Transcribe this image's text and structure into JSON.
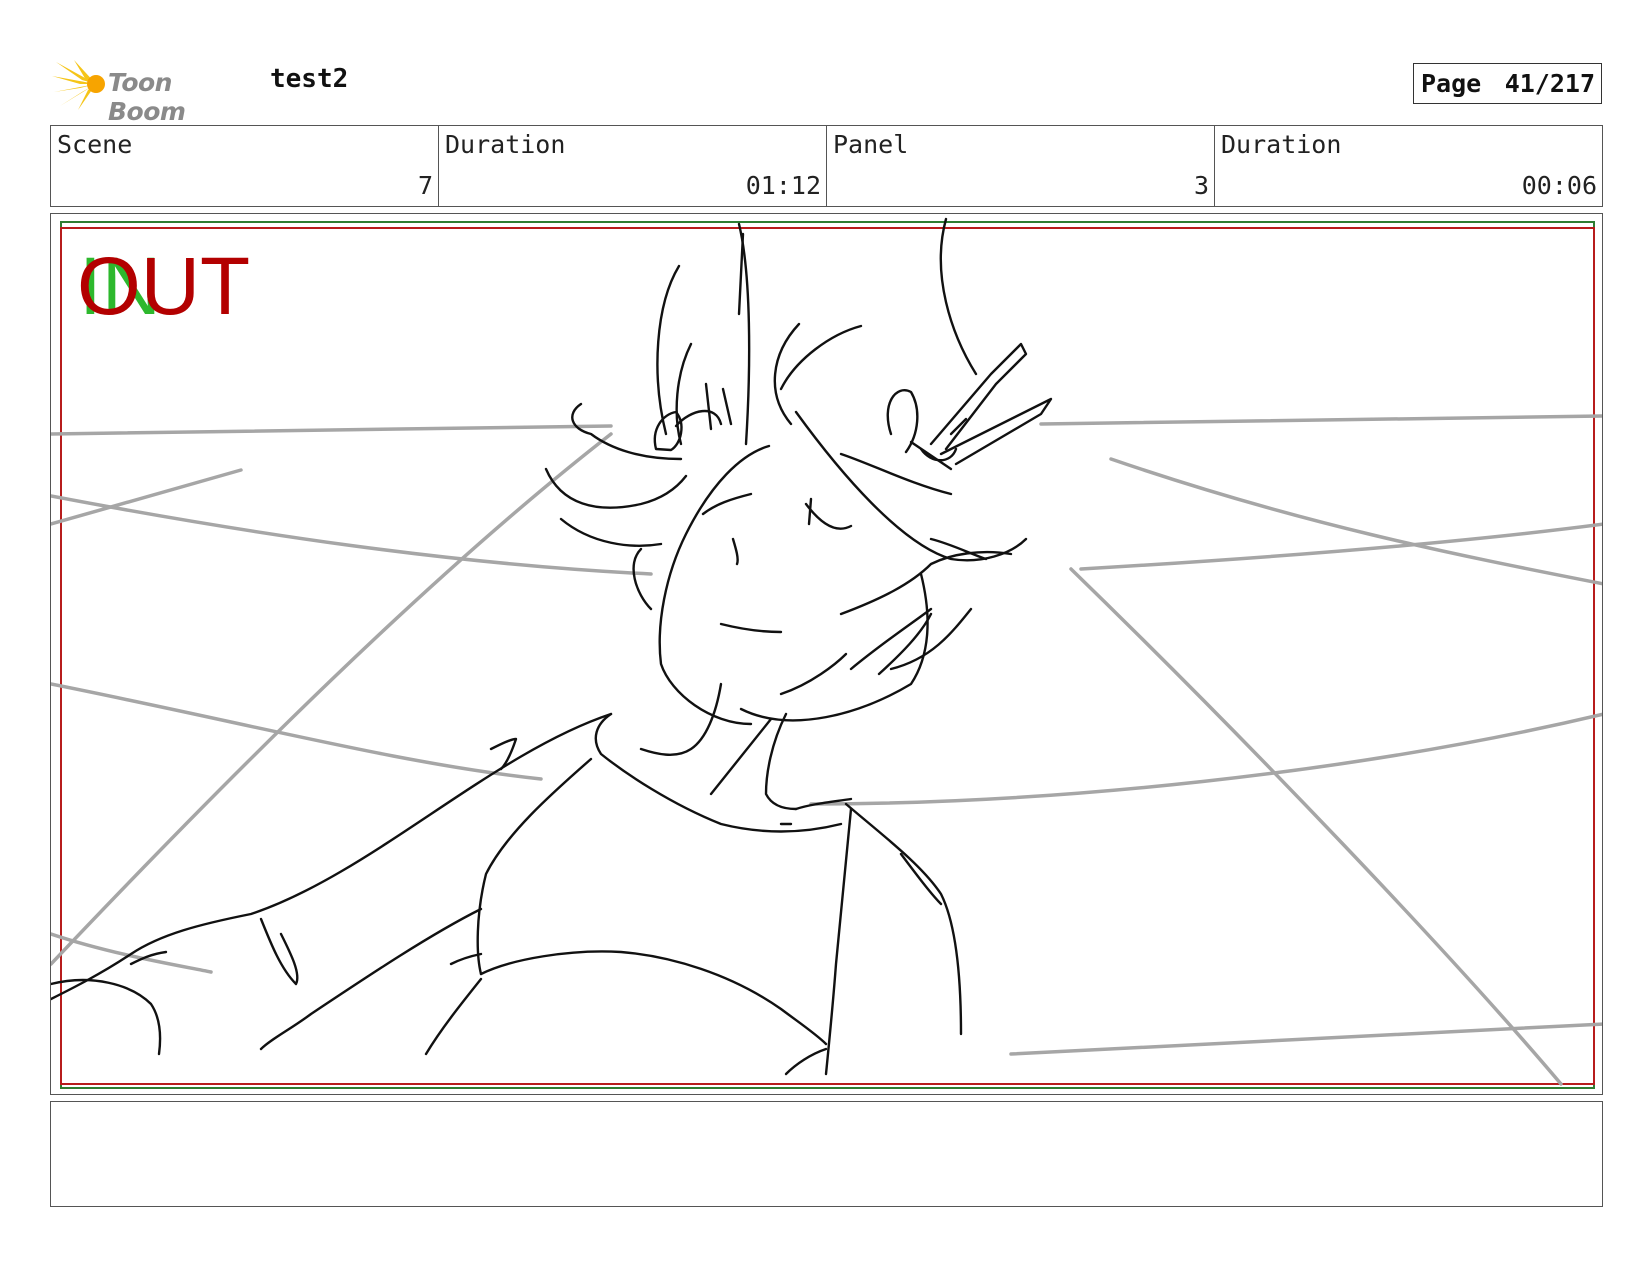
{
  "header": {
    "brand": "Toon Boom",
    "project_title": "test2",
    "page_label": "Page",
    "page_value": "41/217",
    "brand_color": "#f5c518"
  },
  "info": [
    {
      "label": "Scene",
      "value": "7"
    },
    {
      "label": "Duration",
      "value": "01:12"
    },
    {
      "label": "Panel",
      "value": "3"
    },
    {
      "label": "Duration",
      "value": "00:06"
    }
  ],
  "panel": {
    "in_label": "IN",
    "out_label": "OUT",
    "in_color": "#2db82d",
    "out_color": "#b30000",
    "safe_frame_green": "#2e7d32",
    "safe_frame_red": "#b71c1c"
  },
  "notes": {
    "text": ""
  }
}
